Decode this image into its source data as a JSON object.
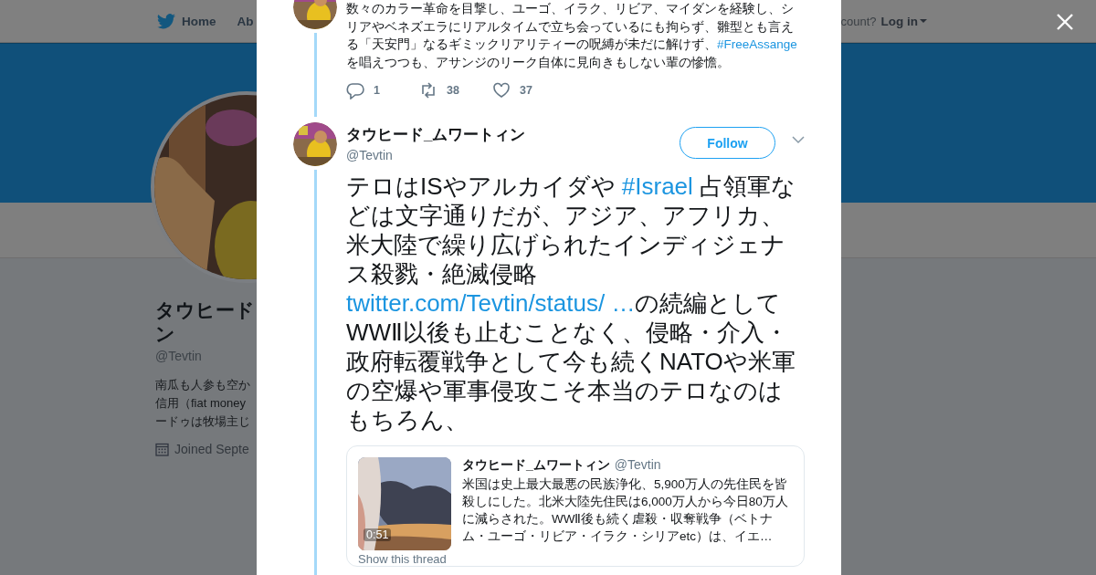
{
  "top_nav": {
    "home": "Home",
    "about": "Ab",
    "account_prompt": "count?",
    "login": "Log in"
  },
  "profile": {
    "name_lines": [
      "タウヒード",
      "ン"
    ],
    "handle": "@Tevtin",
    "bio_lines": [
      "南瓜も人参も空か",
      "信用（fiat money",
      "ードゥは牧場主じ"
    ],
    "joined": "Joined Septe"
  },
  "modal": {
    "previous_tweet": {
      "text": [
        {
          "kind": "text",
          "value": "数々のカラー革命を目撃し、ユーゴ、イラク、リビア、マイダンを経験し、シリアやベネズエラにリアルタイムで立ち会っているにも拘らず、雛型とも言える「天安門」なるギミックリアリティーの呪縛が未だに解けず、"
        },
        {
          "kind": "link",
          "value": "#FreeAssange"
        },
        {
          "kind": "text",
          "value": " を唱えつつも、アサンジのリーク自体に見向きもしない輩の慘憺。"
        }
      ],
      "actions": [
        {
          "kind": "reply",
          "count": "1"
        },
        {
          "kind": "retweet",
          "count": "38"
        },
        {
          "kind": "like",
          "count": "37"
        }
      ]
    },
    "tweet": {
      "name": "タウヒード_ムワートィン",
      "handle": "@Tevtin",
      "follow": "Follow",
      "text": [
        {
          "kind": "text",
          "value": "テロはISやアルカイダや "
        },
        {
          "kind": "link",
          "value": "#Israel"
        },
        {
          "kind": "text",
          "value": " 占領軍などは文字通りだが、アジア、アフリカ、米大陸で繰り広げられたインディジェナス殺戮・絶滅侵略"
        },
        {
          "kind": "link",
          "value": "twitter.com/Tevtin/status/ …"
        },
        {
          "kind": "text",
          "value": "の続編としてWWⅡ以後も止むことなく、侵略・介入・政府転覆戦争として今も続くNATOや米軍の空爆や軍事侵攻こそ本当のテロなのはもちろん、"
        }
      ],
      "quote": {
        "duration": "0:51",
        "name": "タウヒード_ムワートィン",
        "handle": "@Tevtin",
        "text": "米国は史上最大最悪の民族浄化、5,900万人の先住民を皆殺しにした。北米大陸先住民は6,000万人から今日80万人に減らされた。WWⅡ後も続く虐殺・収奪戦争（ベトナム・ユーゴ・リビア・イラク・シリアetc）は、イエ…",
        "thread_link": "Show this thread"
      }
    }
  }
}
